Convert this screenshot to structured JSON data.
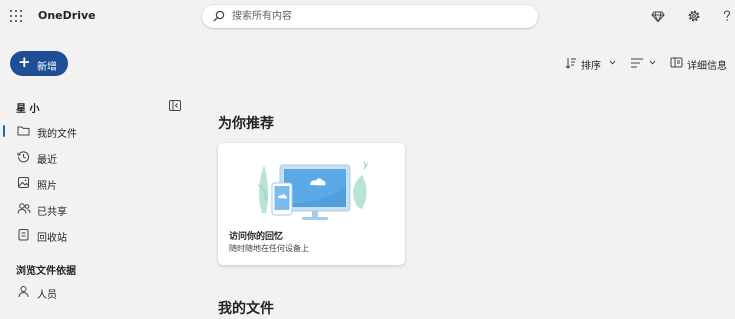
{
  "app": {
    "title": "OneDrive"
  },
  "search": {
    "placeholder": "搜索所有内容"
  },
  "header_icons": [
    "diamond-icon",
    "gear-icon",
    "help-icon"
  ],
  "new_button": {
    "label": "新增"
  },
  "toolbar": {
    "sort_label": "排序",
    "view_icon": "list-view-icon",
    "details_label": "详细信息"
  },
  "sidebar": {
    "user_name": "星 小",
    "items": [
      {
        "label": "我的文件",
        "icon": "folder-icon",
        "active": true
      },
      {
        "label": "最近",
        "icon": "history-icon",
        "active": false
      },
      {
        "label": "照片",
        "icon": "photo-icon",
        "active": false
      },
      {
        "label": "已共享",
        "icon": "people-icon",
        "active": false
      },
      {
        "label": "回收站",
        "icon": "recycle-bin-icon",
        "active": false
      }
    ],
    "browse_heading": "浏览文件依据",
    "browse_items": [
      {
        "label": "人员",
        "icon": "person-icon"
      }
    ]
  },
  "main": {
    "recommended_heading": "为你推荐",
    "card": {
      "title": "访问你的回忆",
      "subtitle": "随时随地在任何设备上"
    },
    "my_files_heading": "我的文件"
  },
  "colors": {
    "accent": "#0f6cbd",
    "new_button": "#1e4f96",
    "background": "#f3f2f1"
  }
}
